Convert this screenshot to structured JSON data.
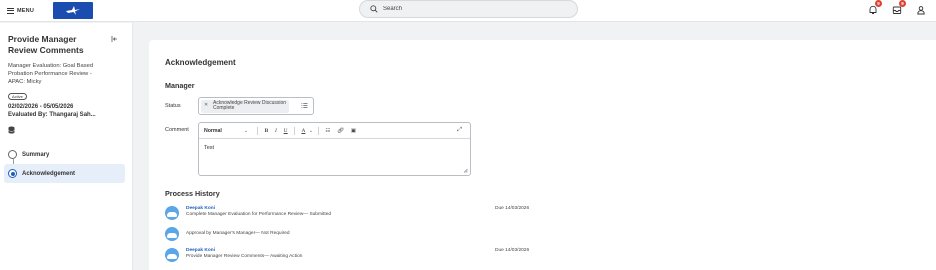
{
  "topbar": {
    "menu_label": "MENU",
    "search_placeholder": "Search",
    "notifications_count": "9",
    "inbox_count": "9"
  },
  "sidebar": {
    "title": "Provide Manager Review Comments",
    "subtitle": "Manager Evaluation: Goal Based Probation Performance Review - APAC: Micky",
    "status_badge": "Active",
    "dates": "02/02/2026 - 05/05/2026",
    "evaluated_by": "Evaluated By: Thangaraj Sah...",
    "steps": [
      {
        "label": "Summary"
      },
      {
        "label": "Acknowledgement"
      }
    ]
  },
  "main": {
    "heading": "Acknowledgement",
    "section": "Manager",
    "status_label": "Status",
    "required_mark": "*",
    "status_value_line1": "Acknowledge Review Discussion",
    "status_value_line2": "Complete",
    "comment_label": "Comment",
    "editor": {
      "style_select": "Normal",
      "text": "Test"
    },
    "process_history_heading": "Process History",
    "history": [
      {
        "name": "Deepak Koni",
        "desc": "Complete Manager Evaluation for Performance Review— Submitted",
        "due": "Due 14/03/2026"
      },
      {
        "name": "",
        "desc": "Approval by Manager's Manager— Not Required",
        "due": ""
      },
      {
        "name": "Deepak Koni",
        "desc": "Provide Manager Review Comments— Awaiting Action",
        "due": "Due 14/03/2026"
      }
    ]
  },
  "colors": {
    "brand_blue": "#1b4db0",
    "link_blue": "#1f5fbf",
    "badge_red": "#de4130",
    "avatar_blue": "#5aa6e6"
  }
}
